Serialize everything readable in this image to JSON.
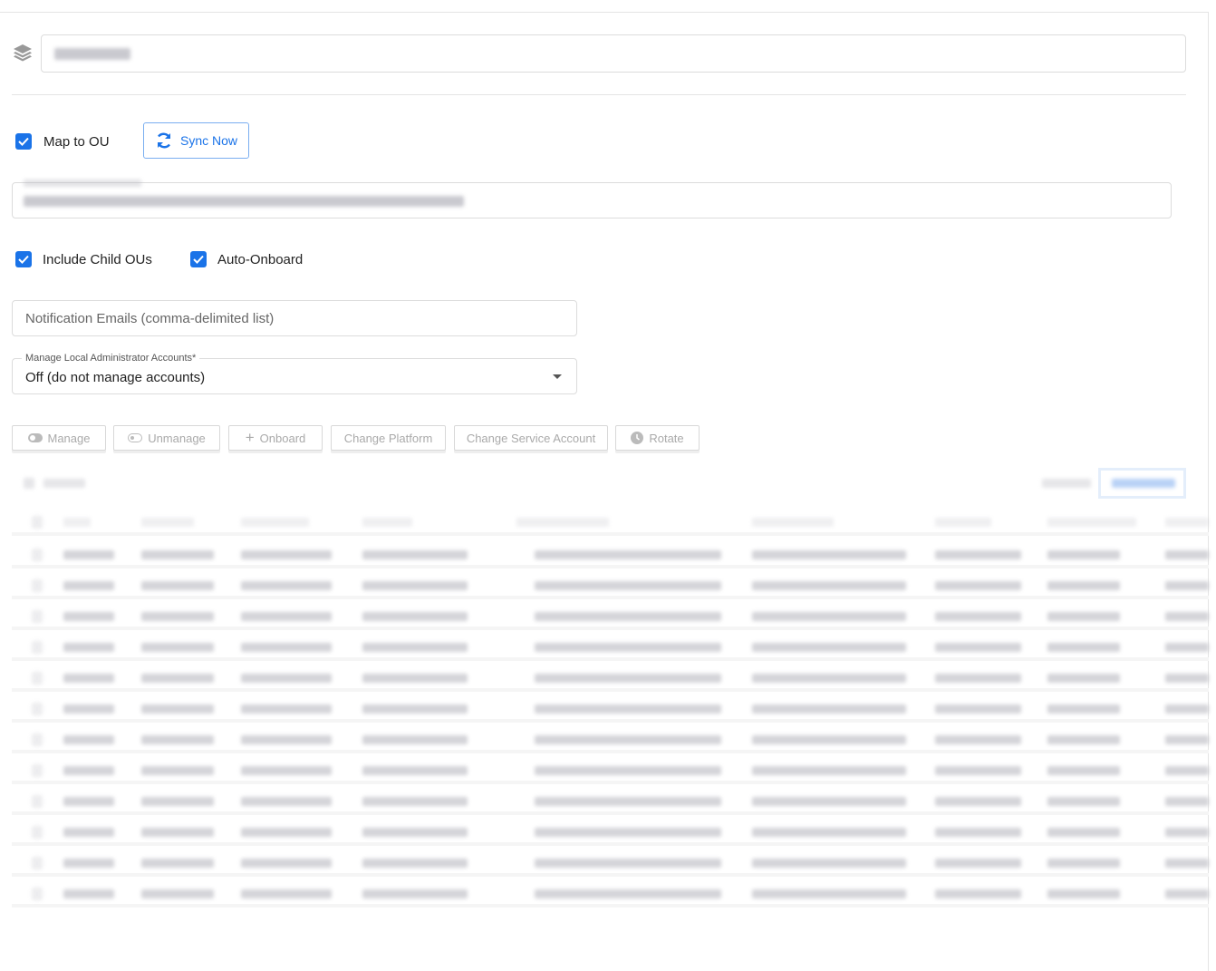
{
  "header": {
    "icon": "layers-icon"
  },
  "map_to_ou": {
    "label": "Map to OU",
    "checked": true
  },
  "sync_button": {
    "label": "Sync Now",
    "icon": "sync-icon"
  },
  "include_child": {
    "label": "Include Child OUs",
    "checked": true
  },
  "auto_onboard": {
    "label": "Auto-Onboard",
    "checked": true
  },
  "notification": {
    "placeholder": "Notification Emails (comma-delimited list)"
  },
  "manage_admin": {
    "label": "Manage Local Administrator Accounts*",
    "value": "Off (do not manage accounts)"
  },
  "toolbar": [
    {
      "label": "Manage",
      "icon": "toggle-on-icon"
    },
    {
      "label": "Unmanage",
      "icon": "toggle-off-icon"
    },
    {
      "label": "Onboard",
      "icon": "plus-icon"
    },
    {
      "label": "Change Platform",
      "icon": ""
    },
    {
      "label": "Change Service Account",
      "icon": ""
    },
    {
      "label": "Rotate",
      "icon": "clock-icon"
    }
  ],
  "accent": "#1a73e8"
}
